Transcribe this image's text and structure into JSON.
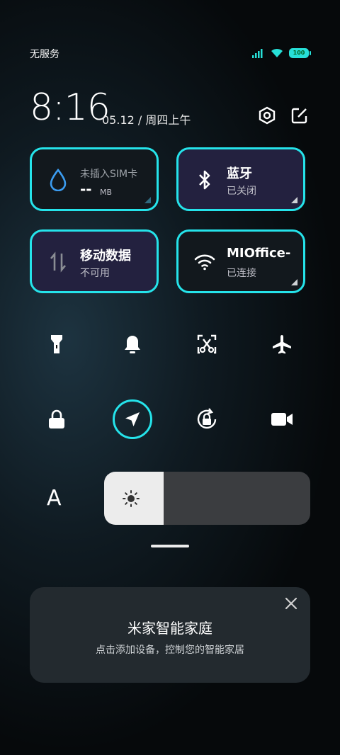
{
  "status_bar": {
    "carrier": "无服务",
    "battery": "100",
    "icons": [
      "signal-icon",
      "wifi-icon",
      "battery-icon"
    ]
  },
  "header": {
    "time": "8:16",
    "date": "05.12 / 周四上午",
    "icons": [
      "settings-hex-icon",
      "edit-icon"
    ]
  },
  "tiles": {
    "data_usage": {
      "title": "未插入SIM卡",
      "value": "--",
      "unit": "MB",
      "icon": "water-drop-icon"
    },
    "bluetooth": {
      "title": "蓝牙",
      "status": "已关闭",
      "icon": "bluetooth-icon"
    },
    "mobile_data": {
      "title": "移动数据",
      "status": "不可用",
      "icon": "data-arrows-icon"
    },
    "wifi": {
      "title": "MIOffice-",
      "status": "已连接",
      "icon": "wifi-icon"
    }
  },
  "quick_toggles": {
    "row1": [
      "flashlight-icon",
      "bell-icon",
      "screenshot-scissors-icon",
      "airplane-icon"
    ],
    "row2": [
      "lock-icon",
      "location-icon",
      "rotation-lock-icon",
      "video-camera-icon"
    ]
  },
  "brightness": {
    "label": "A",
    "level": 0.29
  },
  "smart_home_card": {
    "title": "米家智能家庭",
    "subtitle": "点击添加设备，控制您的智能家居"
  },
  "colors": {
    "accent": "#25e3ea",
    "tile_dark": "#12181d",
    "tile_purple": "#23213f"
  }
}
